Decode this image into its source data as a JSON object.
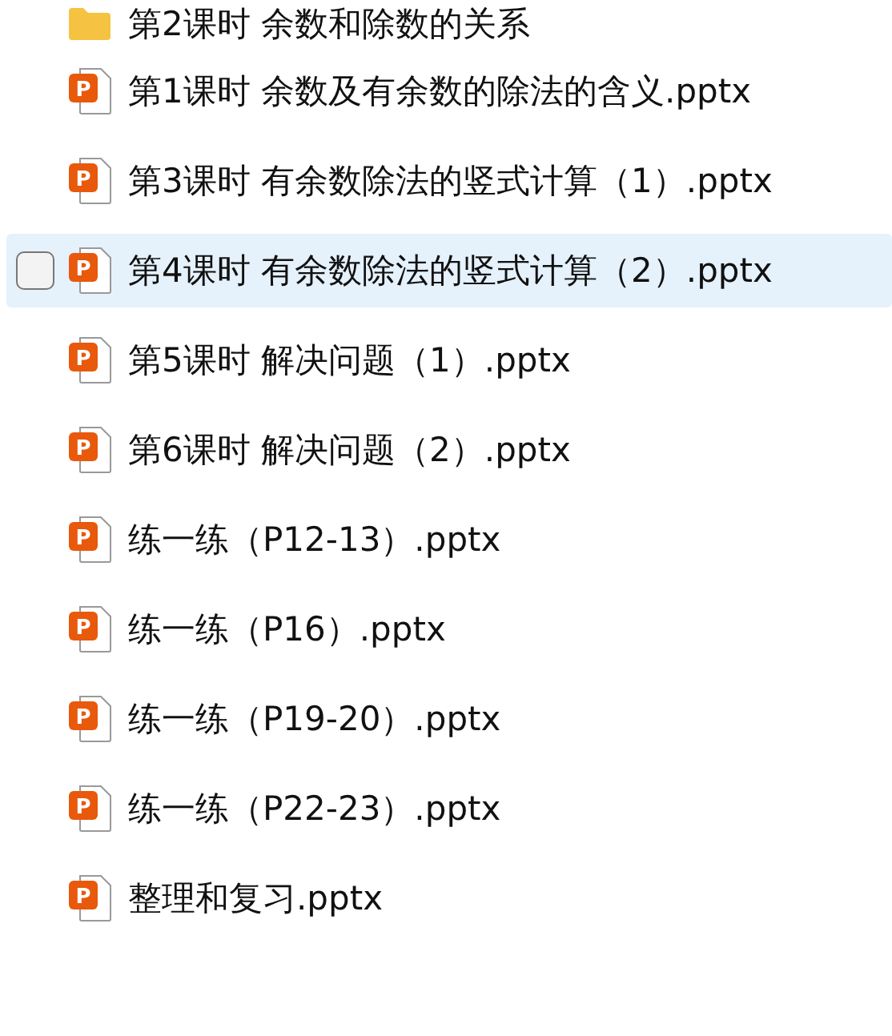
{
  "files": [
    {
      "kind": "folder",
      "name": "第2课时 余数和除数的关系",
      "selected": false
    },
    {
      "kind": "pptx",
      "icon_text": "P",
      "name": "第1课时 余数及有余数的除法的含义.pptx",
      "selected": false
    },
    {
      "kind": "pptx",
      "icon_text": "P",
      "name": "第3课时 有余数除法的竖式计算（1）.pptx",
      "selected": false
    },
    {
      "kind": "pptx",
      "icon_text": "P",
      "name": "第4课时 有余数除法的竖式计算（2）.pptx",
      "selected": true
    },
    {
      "kind": "pptx",
      "icon_text": "P",
      "name": "第5课时 解决问题（1）.pptx",
      "selected": false
    },
    {
      "kind": "pptx",
      "icon_text": "P",
      "name": "第6课时 解决问题（2）.pptx",
      "selected": false
    },
    {
      "kind": "pptx",
      "icon_text": "P",
      "name": "练一练（P12-13）.pptx",
      "selected": false
    },
    {
      "kind": "pptx",
      "icon_text": "P",
      "name": "练一练（P16）.pptx",
      "selected": false
    },
    {
      "kind": "pptx",
      "icon_text": "P",
      "name": "练一练（P19-20）.pptx",
      "selected": false
    },
    {
      "kind": "pptx",
      "icon_text": "P",
      "name": "练一练（P22-23）.pptx",
      "selected": false
    },
    {
      "kind": "pptx",
      "icon_text": "P",
      "name": "整理和复习.pptx",
      "selected": false
    }
  ]
}
